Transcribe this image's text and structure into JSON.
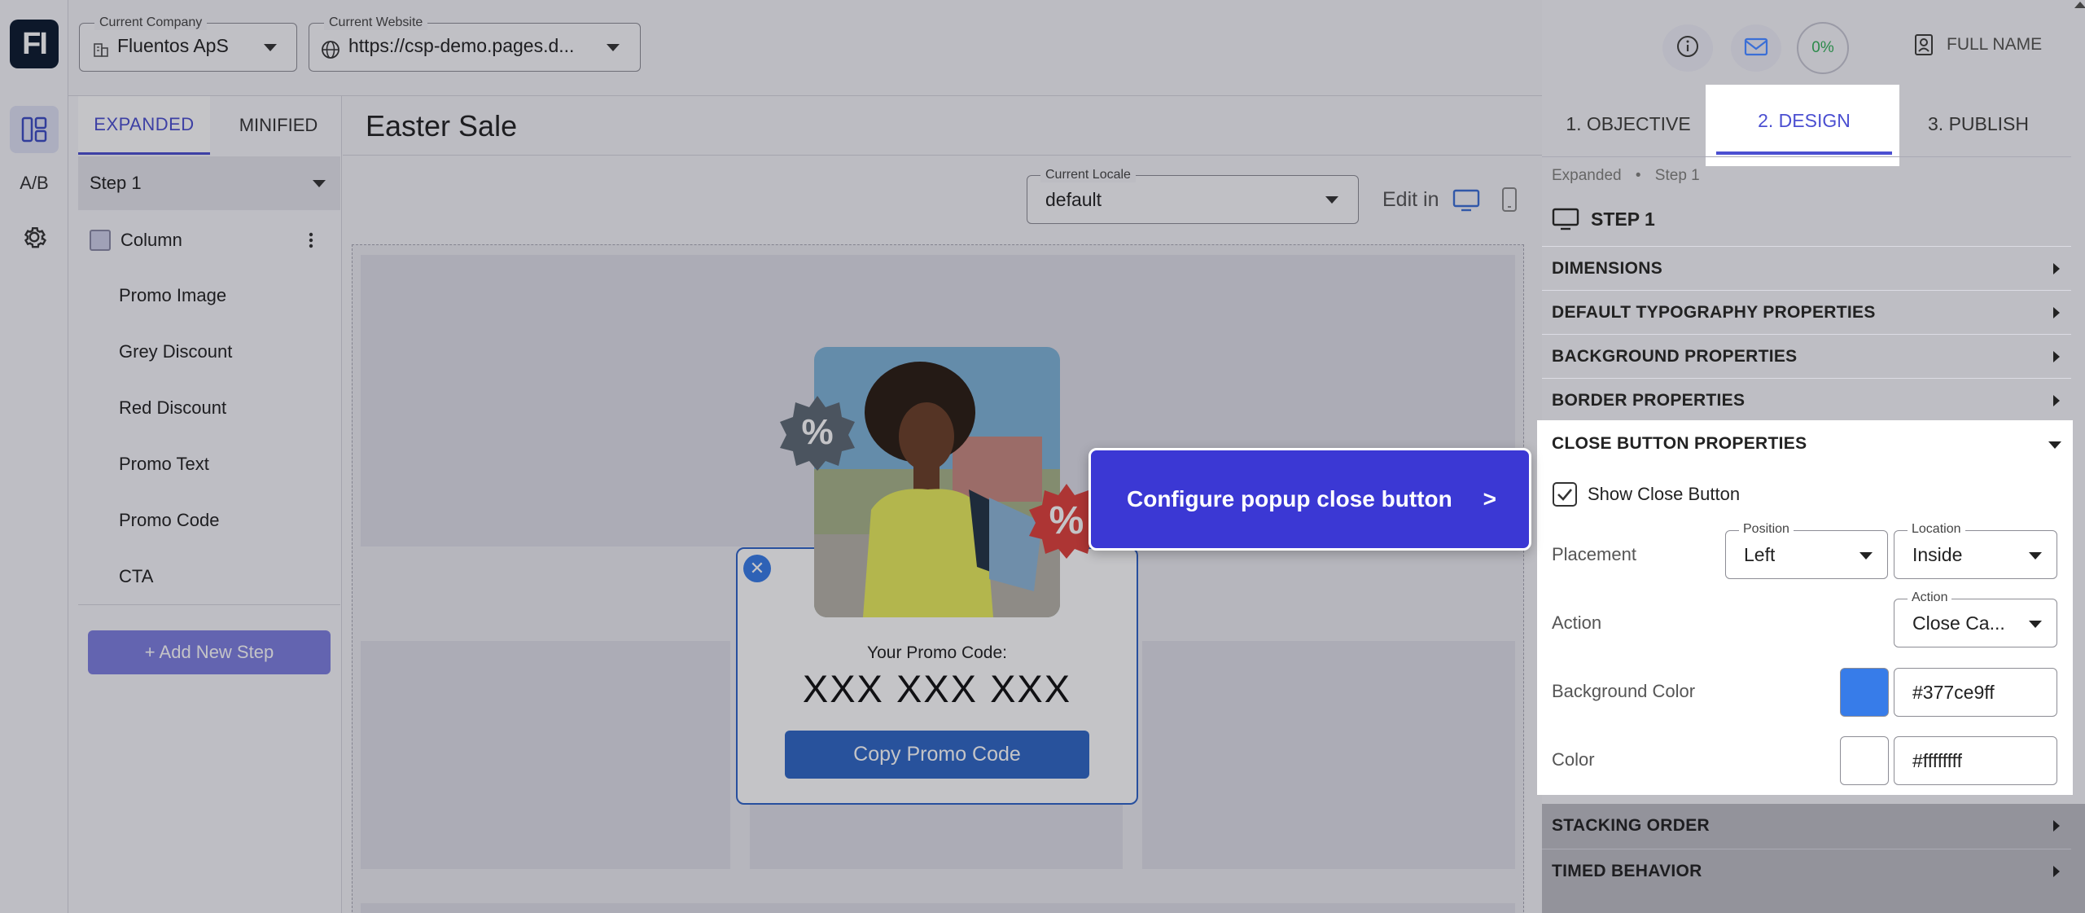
{
  "app": {
    "logo_text": "FI"
  },
  "rail": {
    "ab_label": "A/B"
  },
  "header": {
    "company_label": "Current Company",
    "company_value": "Fluentos ApS",
    "website_label": "Current Website",
    "website_value": "https://csp-demo.pages.d...",
    "progress": "0%",
    "user_name": "FULL NAME"
  },
  "layers": {
    "tabs": [
      "EXPANDED",
      "MINIFIED"
    ],
    "step": "Step 1",
    "column": "Column",
    "items": [
      "Promo Image",
      "Grey Discount",
      "Red Discount",
      "Promo Text",
      "Promo Code",
      "CTA"
    ],
    "add_step": "+ Add New Step"
  },
  "canvas": {
    "title": "Easter Sale",
    "locale_label": "Current Locale",
    "locale_value": "default",
    "edit_in": "Edit in"
  },
  "popup": {
    "promo_label": "Your Promo Code:",
    "promo_code": "XXX XXX XXX",
    "copy_button": "Copy Promo Code",
    "badge_symbol": "%"
  },
  "tour": {
    "text": "Configure popup close button",
    "next": ">"
  },
  "panel": {
    "tabs": [
      "1. OBJECTIVE",
      "2. DESIGN",
      "3. PUBLISH"
    ],
    "breadcrumb": [
      "Expanded",
      "Step 1"
    ],
    "step_heading": "STEP 1",
    "sections": {
      "dimensions": "DIMENSIONS",
      "typography": "DEFAULT TYPOGRAPHY PROPERTIES",
      "background": "BACKGROUND PROPERTIES",
      "border": "BORDER PROPERTIES",
      "close_button": "CLOSE BUTTON PROPERTIES",
      "stacking": "STACKING ORDER",
      "timed": "TIMED BEHAVIOR"
    },
    "close_button": {
      "show_label": "Show Close Button",
      "show_checked": true,
      "placement_label": "Placement",
      "position_label": "Position",
      "position_value": "Left",
      "location_label": "Location",
      "location_value": "Inside",
      "action_label": "Action",
      "action_field_label": "Action",
      "action_value": "Close Ca...",
      "bg_color_label": "Background Color",
      "bg_color_value": "#377ce9ff",
      "bg_swatch": "#377ce9",
      "color_label": "Color",
      "color_value": "#ffffffff",
      "color_swatch": "#ffffff"
    }
  }
}
